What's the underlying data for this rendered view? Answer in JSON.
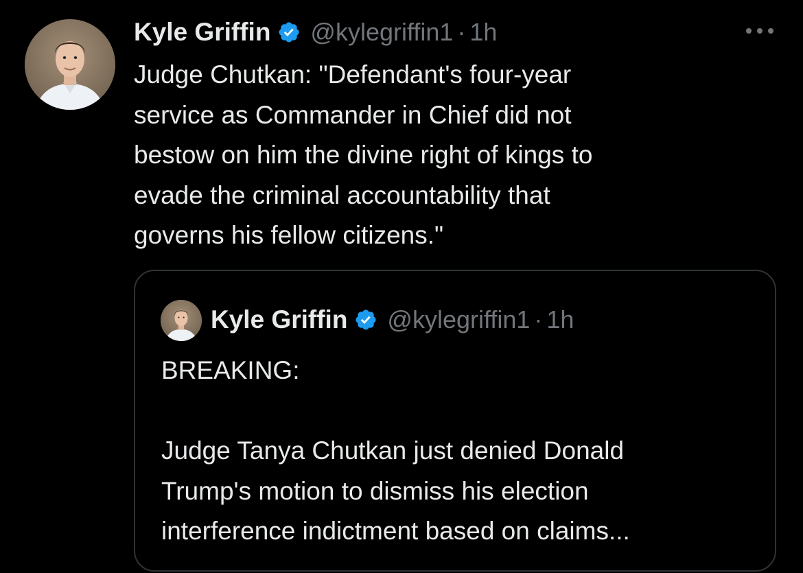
{
  "tweet": {
    "author_name": "Kyle Griffin",
    "handle": "@kylegriffin1",
    "separator": "·",
    "time": "1h",
    "verified": true,
    "text": "Judge Chutkan: \"Defendant's four-year\nservice as Commander in Chief did not\nbestow on him the divine right of kings to\nevade the criminal accountability that\ngoverns his fellow citizens.\"",
    "more_icon": "more-horizontal-icon"
  },
  "quoted_tweet": {
    "author_name": "Kyle Griffin",
    "handle": "@kylegriffin1",
    "separator": "·",
    "time": "1h",
    "verified": true,
    "text": "BREAKING:\n\nJudge Tanya Chutkan just denied Donald\nTrump's motion to dismiss his election\ninterference indictment based on claims..."
  },
  "colors": {
    "background": "#000000",
    "text_primary": "#e7e9ea",
    "text_secondary": "#71767b",
    "verified_badge": "#1d9bf0",
    "border": "#2f3336"
  }
}
